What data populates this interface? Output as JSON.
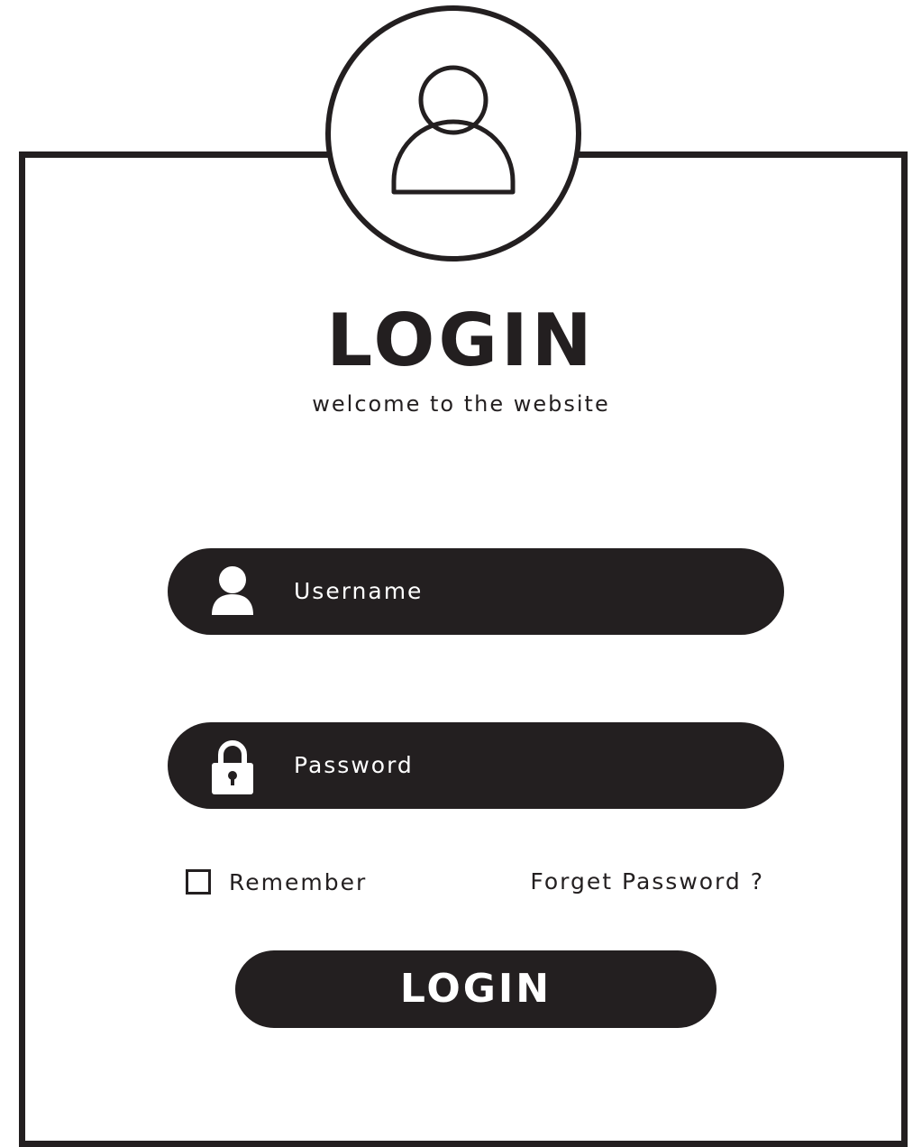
{
  "colors": {
    "ink": "#231f20",
    "background": "#ffffff",
    "on_dark_text": "#ffffff"
  },
  "header": {
    "avatar_icon": "user-outline-icon",
    "title": "LOGIN",
    "subtitle": "welcome to the website"
  },
  "form": {
    "username": {
      "icon": "user-icon",
      "placeholder": "Username"
    },
    "password": {
      "icon": "lock-icon",
      "placeholder": "Password"
    },
    "remember": {
      "label": "Remember",
      "checked": false
    },
    "forgot_link": "Forget Password ?",
    "submit_label": "LOGIN"
  }
}
